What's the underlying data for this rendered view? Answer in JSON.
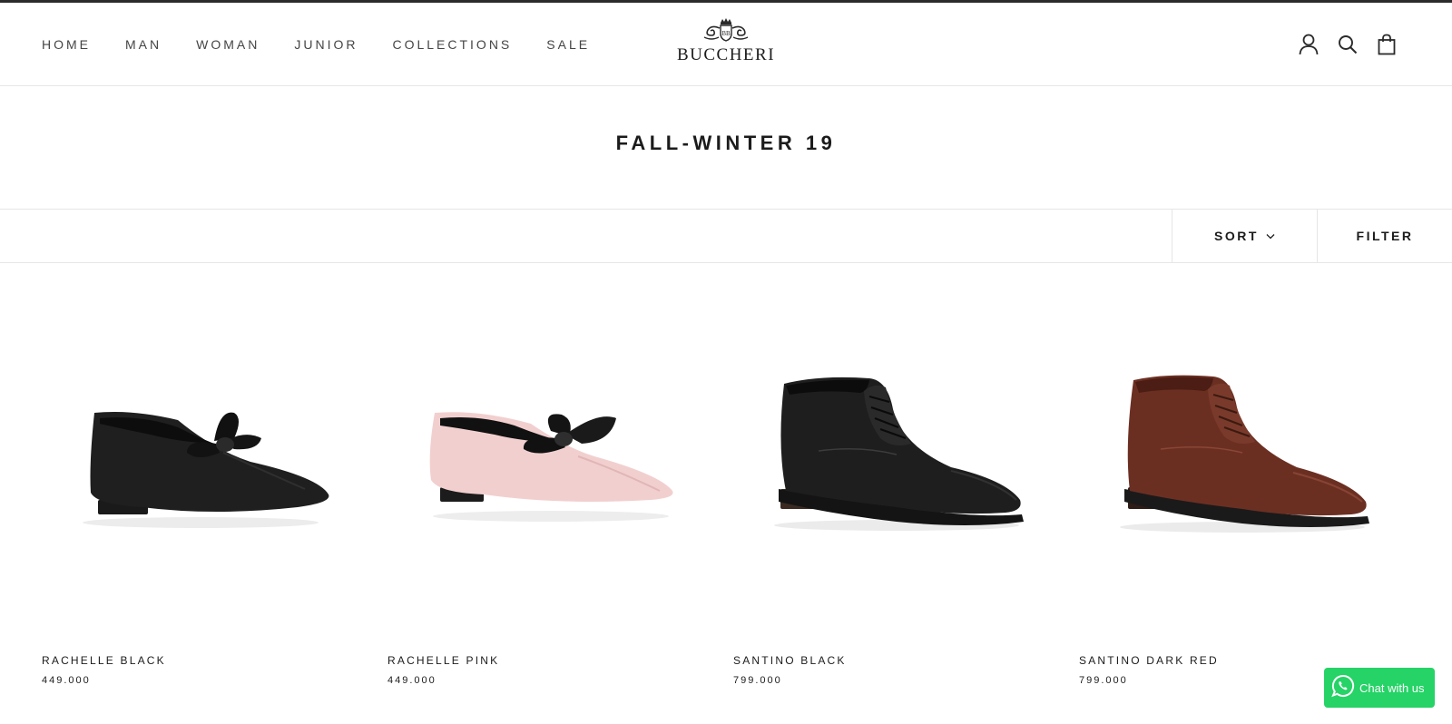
{
  "header": {
    "nav": [
      "HOME",
      "MAN",
      "WOMAN",
      "JUNIOR",
      "COLLECTIONS",
      "SALE"
    ],
    "logo_text": "BUCCHERI",
    "icons": [
      "account-icon",
      "search-icon",
      "cart-icon"
    ]
  },
  "collection": {
    "title": "FALL-WINTER 19"
  },
  "toolbar": {
    "sort_label": "SORT",
    "filter_label": "FILTER"
  },
  "products": [
    {
      "name": "RACHELLE BLACK",
      "price": "449.000",
      "image": "black-ballet-flat-with-bow"
    },
    {
      "name": "RACHELLE PINK",
      "price": "449.000",
      "image": "pink-ballet-flat-with-black-bow"
    },
    {
      "name": "SANTINO BLACK",
      "price": "799.000",
      "image": "black-chukka-boot"
    },
    {
      "name": "SANTINO DARK RED",
      "price": "799.000",
      "image": "dark-red-chukka-boot"
    }
  ],
  "chat": {
    "label": "Chat with us",
    "color": "#25d366"
  }
}
